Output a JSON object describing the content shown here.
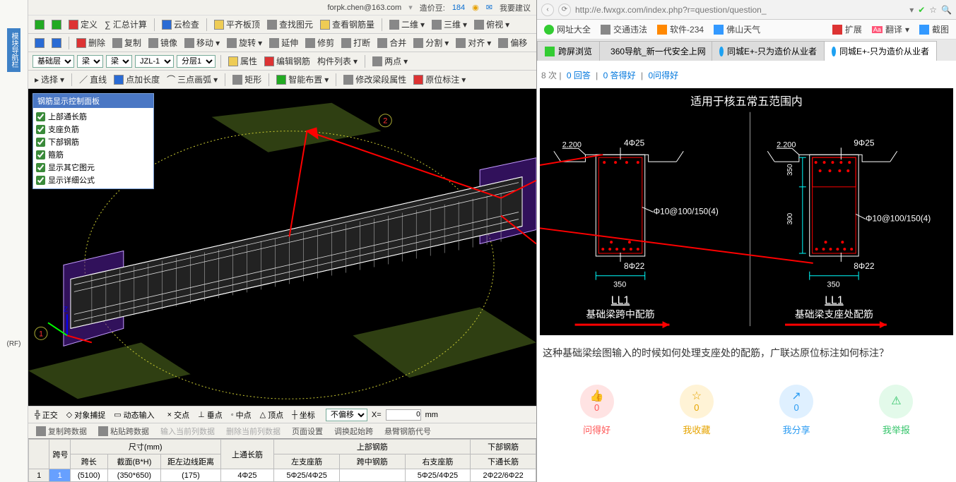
{
  "left": {
    "account": {
      "email": "forpk.chen@163.com",
      "credit_label": "造价豆:",
      "credit_value": "184",
      "suggest": "我要建议"
    },
    "gutter": {
      "vtab": "模块导航栏",
      "lbl_rf": "(RF)"
    },
    "toolbar1": {
      "def": "定义",
      "sum": "∑ 汇总计算",
      "cloud": "云检查",
      "flat": "平齐板顶",
      "find": "查找图元",
      "rebar_qty": "查看钢筋量",
      "view2d": "二维",
      "view3d": "三维",
      "viewOther": "俯视"
    },
    "toolbar2": {
      "del": "删除",
      "copy": "复制",
      "mirror": "镜像",
      "move": "移动",
      "rotate": "旋转",
      "extend": "延伸",
      "trim": "修剪",
      "break": "打断",
      "merge": "合并",
      "split": "分割",
      "align": "对齐",
      "offset": "偏移"
    },
    "toolbar3": {
      "c1": "基础层",
      "c2": "梁",
      "c3": "梁",
      "c4": "JZL-1",
      "c5": "分层1",
      "prop": "属性",
      "editRebar": "编辑钢筋",
      "compList": "构件列表",
      "twoPt": "两点"
    },
    "toolbar4": {
      "select": "选择",
      "line": "直线",
      "ptAdd": "点加长度",
      "arc3": "三点画弧",
      "rect": "矩形",
      "smartLayout": "智能布置",
      "modSpan": "修改梁段属性",
      "inplace": "原位标注"
    },
    "rebar_panel": {
      "title": "钢筋显示控制面板",
      "items": [
        "上部通长筋",
        "支座负筋",
        "下部钢筋",
        "箍筋",
        "显示其它图元",
        "显示详细公式"
      ]
    },
    "snapbar": {
      "ortho": "正交",
      "osnap": "对象捕捉",
      "dyn": "动态输入",
      "int": "交点",
      "perp": "垂点",
      "mid": "中点",
      "apex": "顶点",
      "coord": "坐标",
      "noOffset": "不偏移",
      "x_val": "0",
      "unit": "mm"
    },
    "cmdbar": {
      "copySpan": "复制跨数据",
      "pasteSpan": "粘贴跨数据",
      "inputCur": "输入当前列数据",
      "delCur": "删除当前列数据",
      "pageSet": "页面设置",
      "backStart": "调换起始跨",
      "cantCode": "悬臂钢筋代号"
    },
    "table": {
      "group_dim": "尺寸(mm)",
      "group_top": "上部钢筋",
      "group_bot": "下部钢筋",
      "h_span": "跨号",
      "h_len": "跨长",
      "h_sec": "截面(B*H)",
      "h_edge": "距左边线距离",
      "h_topthru": "上通长筋",
      "h_lsup": "左支座筋",
      "h_midtop": "跨中钢筋",
      "h_rsup": "右支座筋",
      "h_botthru": "下通长筋",
      "row": {
        "idx": "1",
        "span": "1",
        "len": "(5100)",
        "sec": "(350*650)",
        "edge": "(175)",
        "topthru": "4Φ25",
        "lsup": "5Φ25/4Φ25",
        "midtop": "",
        "rsup": "5Φ25/4Φ25",
        "botthru": "2Φ22/6Φ22"
      }
    }
  },
  "right": {
    "url": "http://e.fwxgx.com/index.php?r=question/question_",
    "bookmarks": {
      "b1": "网址大全",
      "b2": "交通违法",
      "b3": "软件-234",
      "b4": "佛山天气",
      "ext": "扩展",
      "trans": "翻译",
      "shot": "截图"
    },
    "tabs": {
      "t1": "跨屏浏览",
      "t2": "360导航_新一代安全上网",
      "t3": "同城E+-只为造价从业者",
      "t4": "同城E+-只为造价从业者"
    },
    "crumbs": {
      "views": "8 次",
      "ans": "0 回答",
      "good": "0 答得好",
      "ask": "0问得好"
    },
    "drawing": {
      "title": "适用于核五常五范围内",
      "left": {
        "name": "LL1",
        "sub": "基础梁跨中配筋",
        "top": "4Φ25",
        "stir": "Φ10@100/150(4)",
        "bot": "8Φ22",
        "w": "350",
        "elev": "2.200"
      },
      "right": {
        "name": "LL1",
        "sub": "基础梁支座处配筋",
        "top": "9Φ25",
        "stir": "Φ10@100/150(4)",
        "bot": "8Φ22",
        "w": "350",
        "h1": "350",
        "h2": "300",
        "elev": "2.200"
      }
    },
    "question": "这种基础梁绘图输入的时候如何处理支座处的配筋，广联达原位标注如何标注？",
    "actions": {
      "good": {
        "label": "问得好",
        "count": "0"
      },
      "fav": {
        "label": "我收藏",
        "count": "0"
      },
      "share": {
        "label": "我分享",
        "count": "0"
      },
      "rep": {
        "label": "我举报"
      }
    }
  }
}
